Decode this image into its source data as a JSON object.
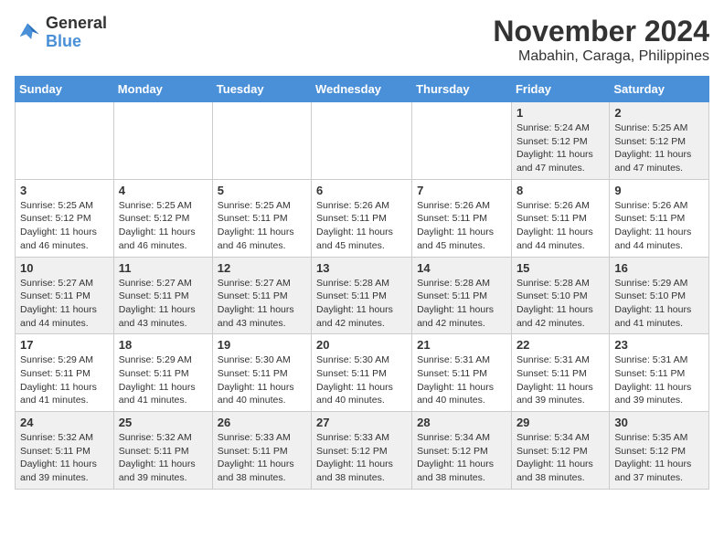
{
  "header": {
    "logo_general": "General",
    "logo_blue": "Blue",
    "month_year": "November 2024",
    "location": "Mabahin, Caraga, Philippines"
  },
  "days_of_week": [
    "Sunday",
    "Monday",
    "Tuesday",
    "Wednesday",
    "Thursday",
    "Friday",
    "Saturday"
  ],
  "weeks": [
    [
      {
        "day": null,
        "info": null
      },
      {
        "day": null,
        "info": null
      },
      {
        "day": null,
        "info": null
      },
      {
        "day": null,
        "info": null
      },
      {
        "day": null,
        "info": null
      },
      {
        "day": "1",
        "info": "Sunrise: 5:24 AM\nSunset: 5:12 PM\nDaylight: 11 hours\nand 47 minutes."
      },
      {
        "day": "2",
        "info": "Sunrise: 5:25 AM\nSunset: 5:12 PM\nDaylight: 11 hours\nand 47 minutes."
      }
    ],
    [
      {
        "day": "3",
        "info": "Sunrise: 5:25 AM\nSunset: 5:12 PM\nDaylight: 11 hours\nand 46 minutes."
      },
      {
        "day": "4",
        "info": "Sunrise: 5:25 AM\nSunset: 5:12 PM\nDaylight: 11 hours\nand 46 minutes."
      },
      {
        "day": "5",
        "info": "Sunrise: 5:25 AM\nSunset: 5:11 PM\nDaylight: 11 hours\nand 46 minutes."
      },
      {
        "day": "6",
        "info": "Sunrise: 5:26 AM\nSunset: 5:11 PM\nDaylight: 11 hours\nand 45 minutes."
      },
      {
        "day": "7",
        "info": "Sunrise: 5:26 AM\nSunset: 5:11 PM\nDaylight: 11 hours\nand 45 minutes."
      },
      {
        "day": "8",
        "info": "Sunrise: 5:26 AM\nSunset: 5:11 PM\nDaylight: 11 hours\nand 44 minutes."
      },
      {
        "day": "9",
        "info": "Sunrise: 5:26 AM\nSunset: 5:11 PM\nDaylight: 11 hours\nand 44 minutes."
      }
    ],
    [
      {
        "day": "10",
        "info": "Sunrise: 5:27 AM\nSunset: 5:11 PM\nDaylight: 11 hours\nand 44 minutes."
      },
      {
        "day": "11",
        "info": "Sunrise: 5:27 AM\nSunset: 5:11 PM\nDaylight: 11 hours\nand 43 minutes."
      },
      {
        "day": "12",
        "info": "Sunrise: 5:27 AM\nSunset: 5:11 PM\nDaylight: 11 hours\nand 43 minutes."
      },
      {
        "day": "13",
        "info": "Sunrise: 5:28 AM\nSunset: 5:11 PM\nDaylight: 11 hours\nand 42 minutes."
      },
      {
        "day": "14",
        "info": "Sunrise: 5:28 AM\nSunset: 5:11 PM\nDaylight: 11 hours\nand 42 minutes."
      },
      {
        "day": "15",
        "info": "Sunrise: 5:28 AM\nSunset: 5:10 PM\nDaylight: 11 hours\nand 42 minutes."
      },
      {
        "day": "16",
        "info": "Sunrise: 5:29 AM\nSunset: 5:10 PM\nDaylight: 11 hours\nand 41 minutes."
      }
    ],
    [
      {
        "day": "17",
        "info": "Sunrise: 5:29 AM\nSunset: 5:11 PM\nDaylight: 11 hours\nand 41 minutes."
      },
      {
        "day": "18",
        "info": "Sunrise: 5:29 AM\nSunset: 5:11 PM\nDaylight: 11 hours\nand 41 minutes."
      },
      {
        "day": "19",
        "info": "Sunrise: 5:30 AM\nSunset: 5:11 PM\nDaylight: 11 hours\nand 40 minutes."
      },
      {
        "day": "20",
        "info": "Sunrise: 5:30 AM\nSunset: 5:11 PM\nDaylight: 11 hours\nand 40 minutes."
      },
      {
        "day": "21",
        "info": "Sunrise: 5:31 AM\nSunset: 5:11 PM\nDaylight: 11 hours\nand 40 minutes."
      },
      {
        "day": "22",
        "info": "Sunrise: 5:31 AM\nSunset: 5:11 PM\nDaylight: 11 hours\nand 39 minutes."
      },
      {
        "day": "23",
        "info": "Sunrise: 5:31 AM\nSunset: 5:11 PM\nDaylight: 11 hours\nand 39 minutes."
      }
    ],
    [
      {
        "day": "24",
        "info": "Sunrise: 5:32 AM\nSunset: 5:11 PM\nDaylight: 11 hours\nand 39 minutes."
      },
      {
        "day": "25",
        "info": "Sunrise: 5:32 AM\nSunset: 5:11 PM\nDaylight: 11 hours\nand 39 minutes."
      },
      {
        "day": "26",
        "info": "Sunrise: 5:33 AM\nSunset: 5:11 PM\nDaylight: 11 hours\nand 38 minutes."
      },
      {
        "day": "27",
        "info": "Sunrise: 5:33 AM\nSunset: 5:12 PM\nDaylight: 11 hours\nand 38 minutes."
      },
      {
        "day": "28",
        "info": "Sunrise: 5:34 AM\nSunset: 5:12 PM\nDaylight: 11 hours\nand 38 minutes."
      },
      {
        "day": "29",
        "info": "Sunrise: 5:34 AM\nSunset: 5:12 PM\nDaylight: 11 hours\nand 38 minutes."
      },
      {
        "day": "30",
        "info": "Sunrise: 5:35 AM\nSunset: 5:12 PM\nDaylight: 11 hours\nand 37 minutes."
      }
    ]
  ]
}
